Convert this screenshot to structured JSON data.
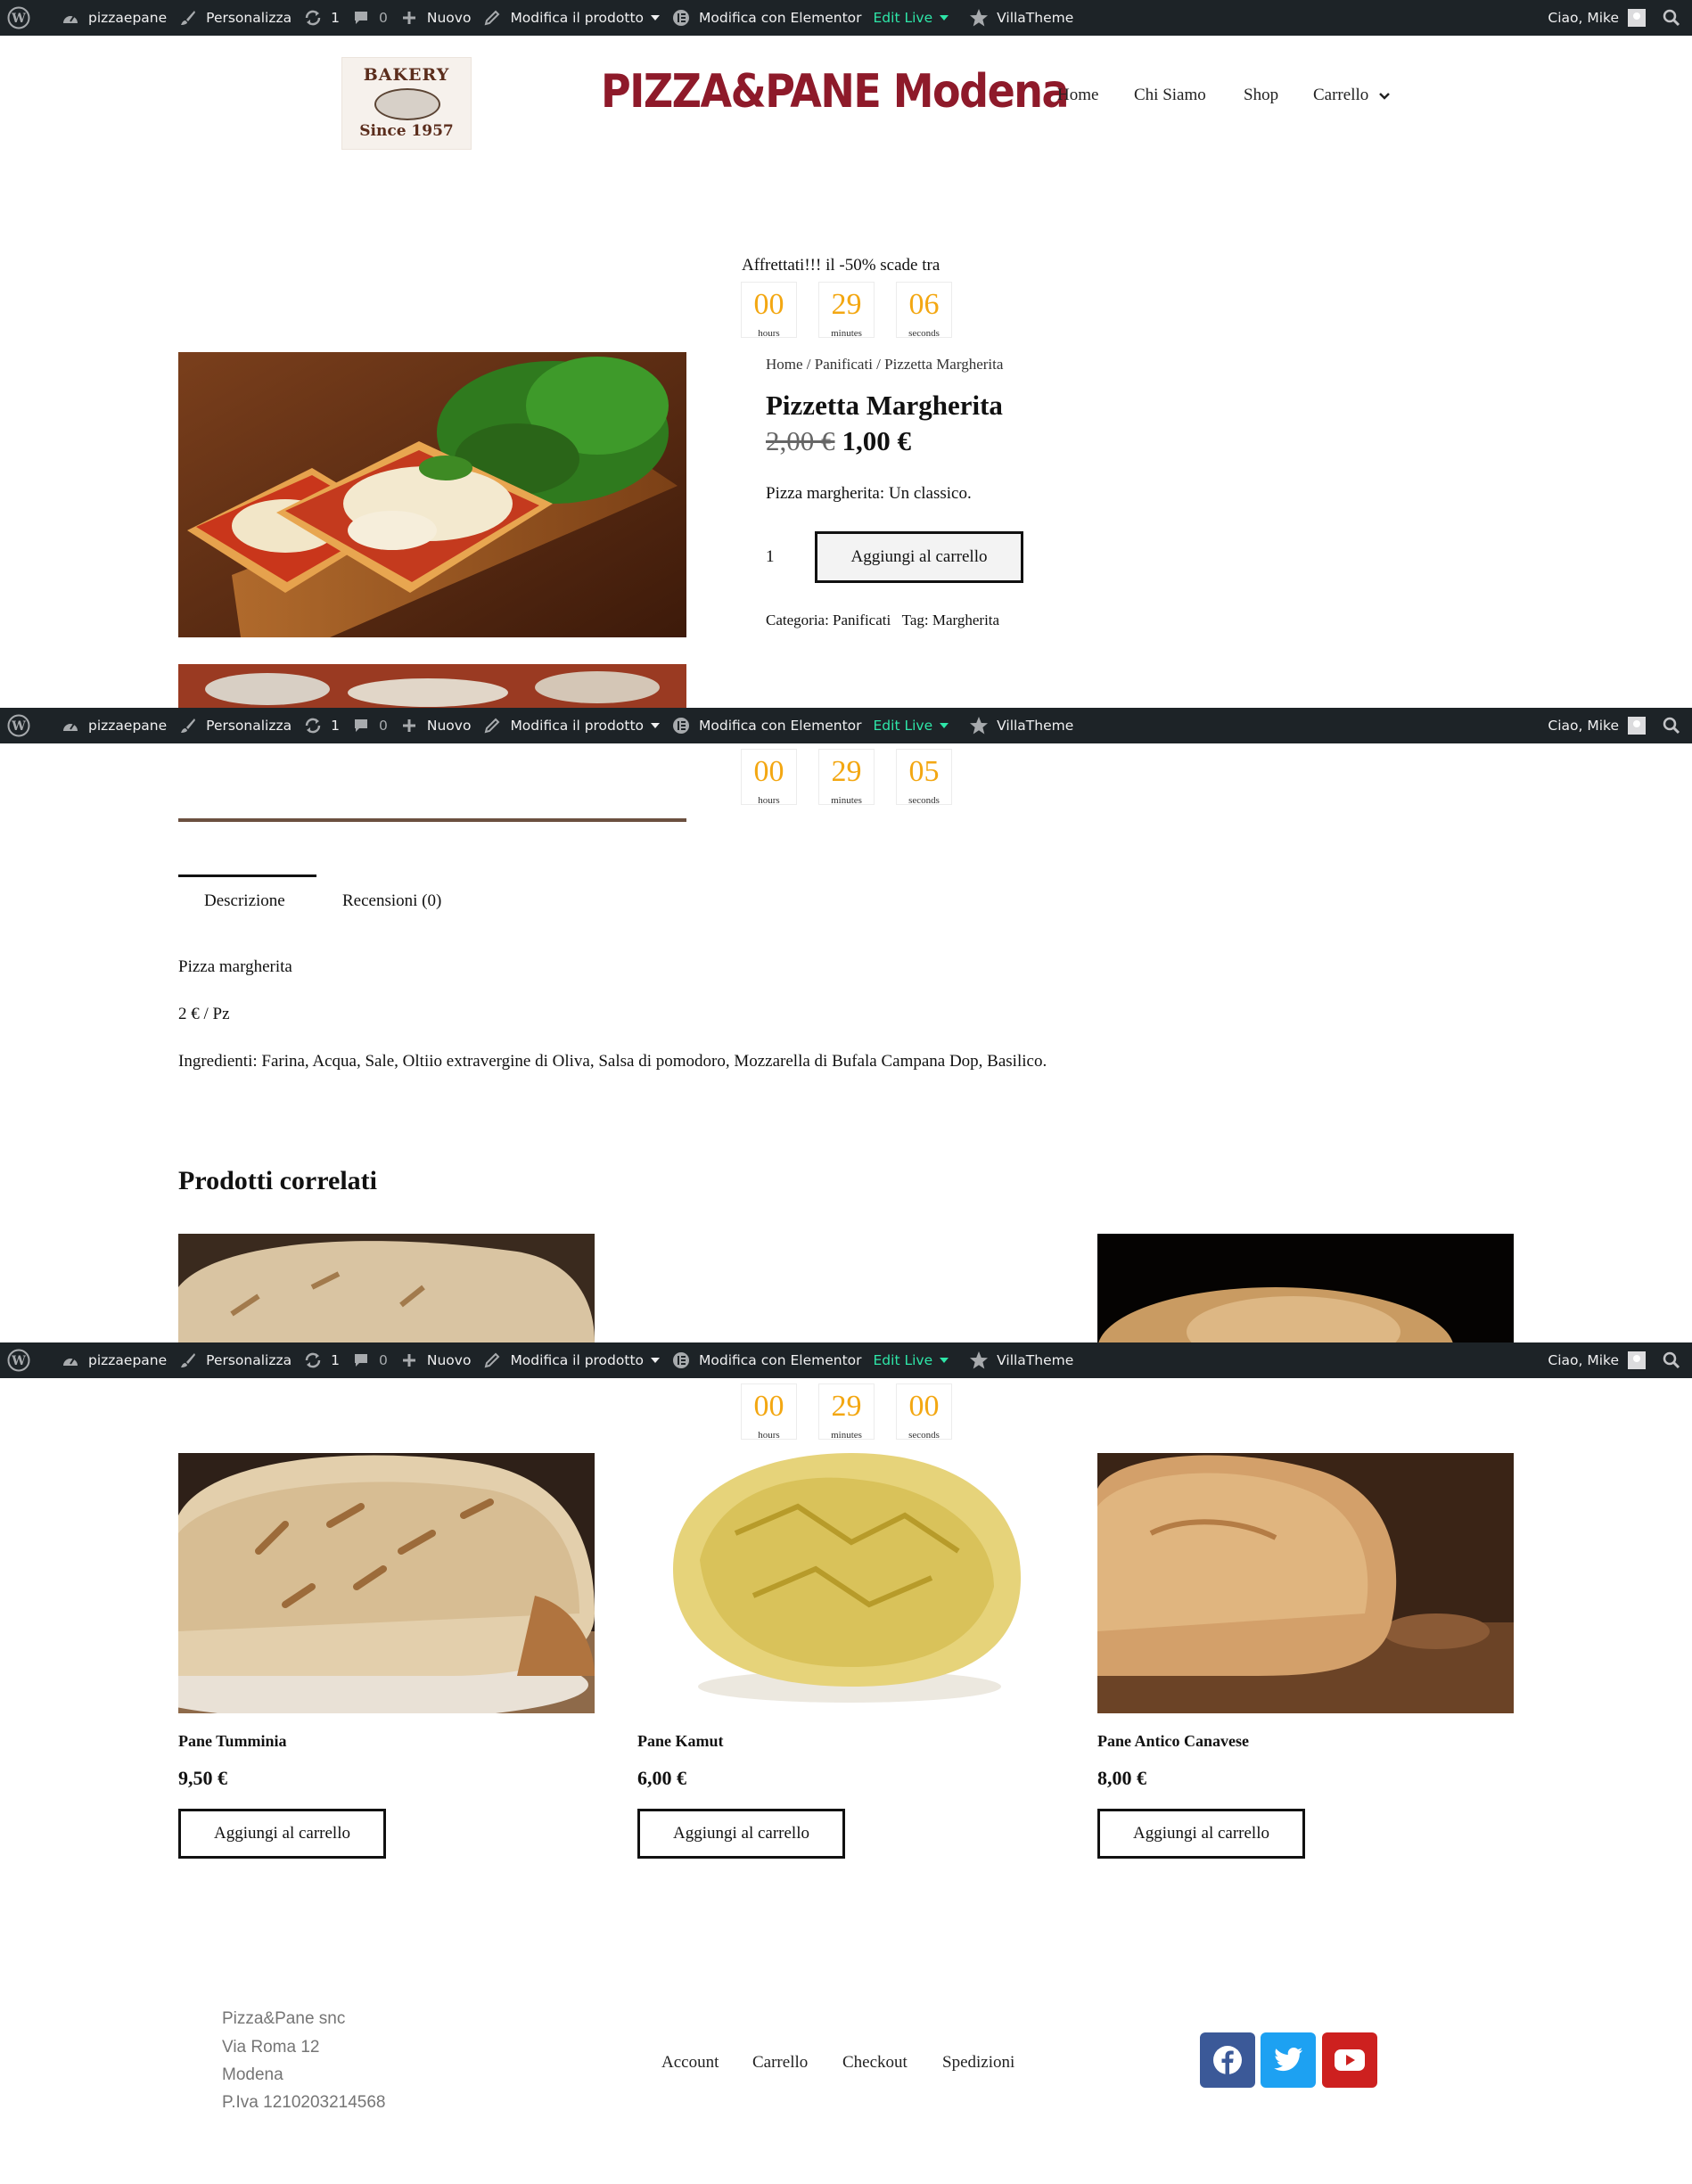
{
  "adminbar": {
    "site": "pizzaepane",
    "customize": "Personalizza",
    "updates": "1",
    "comments": "0",
    "new": "Nuovo",
    "edit_product": "Modifica il prodotto",
    "elementor": "Modifica con Elementor",
    "edit_live": "Edit Live",
    "villatheme": "VillaTheme",
    "greeting": "Ciao, Mike"
  },
  "header": {
    "logo_top": "BAKERY",
    "logo_bottom": "Since 1957",
    "brand": "PIZZA&PANE Modena",
    "nav": [
      "Home",
      "Chi Siamo",
      "Shop",
      "Carrello"
    ]
  },
  "countdown": {
    "label": "Affrettati!!! il -50% scade tra",
    "units": [
      "hours",
      "minutes",
      "seconds"
    ],
    "snapshots": [
      [
        "00",
        "29",
        "06"
      ],
      [
        "00",
        "29",
        "05"
      ],
      [
        "00",
        "29",
        "00"
      ]
    ]
  },
  "product": {
    "breadcrumb": "Home / Panificati / Pizzetta Margherita",
    "title": "Pizzetta Margherita",
    "old_price": "2,00 €",
    "price": "1,00 €",
    "short_description": "Pizza margherita: Un classico.",
    "quantity": "1",
    "add_to_cart": "Aggiungi al carrello",
    "meta": "Categoria: Panificati   Tag: Margherita"
  },
  "tabs": [
    "Descrizione",
    "Recensioni (0)"
  ],
  "description": [
    "Pizza margherita",
    "2 € / Pz",
    "Ingredienti: Farina, Acqua, Sale, Oltiio extravergine di Oliva, Salsa di pomodoro, Mozzarella di Bufala Campana Dop, Basilico."
  ],
  "related": {
    "title": "Prodotti correlati",
    "items": [
      {
        "name": "Pane Tumminia",
        "price": "9,50 €",
        "button": "Aggiungi al carrello"
      },
      {
        "name": "Pane Kamut",
        "price": "6,00 €",
        "button": "Aggiungi al carrello"
      },
      {
        "name": "Pane Antico Canavese",
        "price": "8,00 €",
        "button": "Aggiungi al carrello"
      }
    ]
  },
  "footer": {
    "address": [
      "Pizza&Pane snc",
      "Via Roma 12",
      "Modena",
      "P.Iva 1210203214568"
    ],
    "links": [
      "Account",
      "Carrello",
      "Checkout",
      "Spedizioni"
    ],
    "social_icons": [
      "facebook-icon",
      "twitter-icon",
      "youtube-icon"
    ],
    "colors": {
      "facebook": "#3b5998",
      "twitter": "#1da1f2",
      "youtube": "#cd201f",
      "brand": "#8e1a2a",
      "countdown": "#f3a712"
    }
  }
}
